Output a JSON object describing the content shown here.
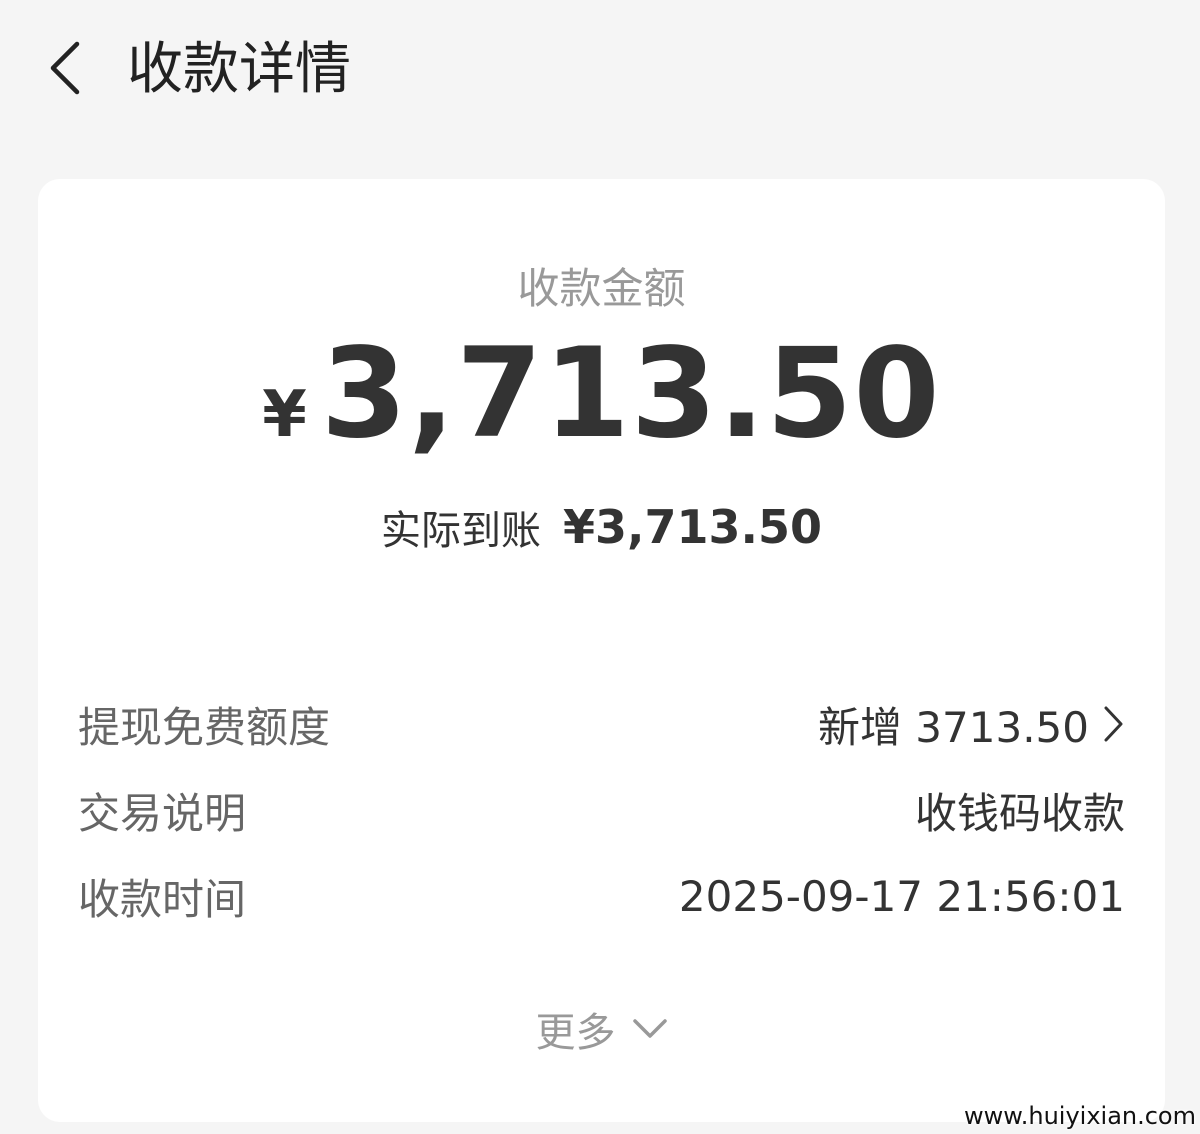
{
  "header": {
    "title": "收款详情",
    "back_icon": "chevron-left-icon"
  },
  "amount": {
    "label": "收款金额",
    "currency": "¥",
    "value": "3,713.50"
  },
  "received": {
    "label": "实际到账",
    "value": "¥3,713.50"
  },
  "details": [
    {
      "label": "提现免费额度",
      "value": "新增 3713.50",
      "icon": "chevron-right-icon"
    },
    {
      "label": "交易说明",
      "value": "收钱码收款"
    },
    {
      "label": "收款时间",
      "value": "2025-09-17 21:56:01"
    }
  ],
  "more": {
    "label": "更多",
    "icon": "chevron-down-icon"
  },
  "watermark": "www.huiyixian.com",
  "colors": {
    "background": "#f5f5f5",
    "card": "#ffffff",
    "primary_text": "#333333",
    "secondary_text": "#999999",
    "label_text": "#666666"
  }
}
